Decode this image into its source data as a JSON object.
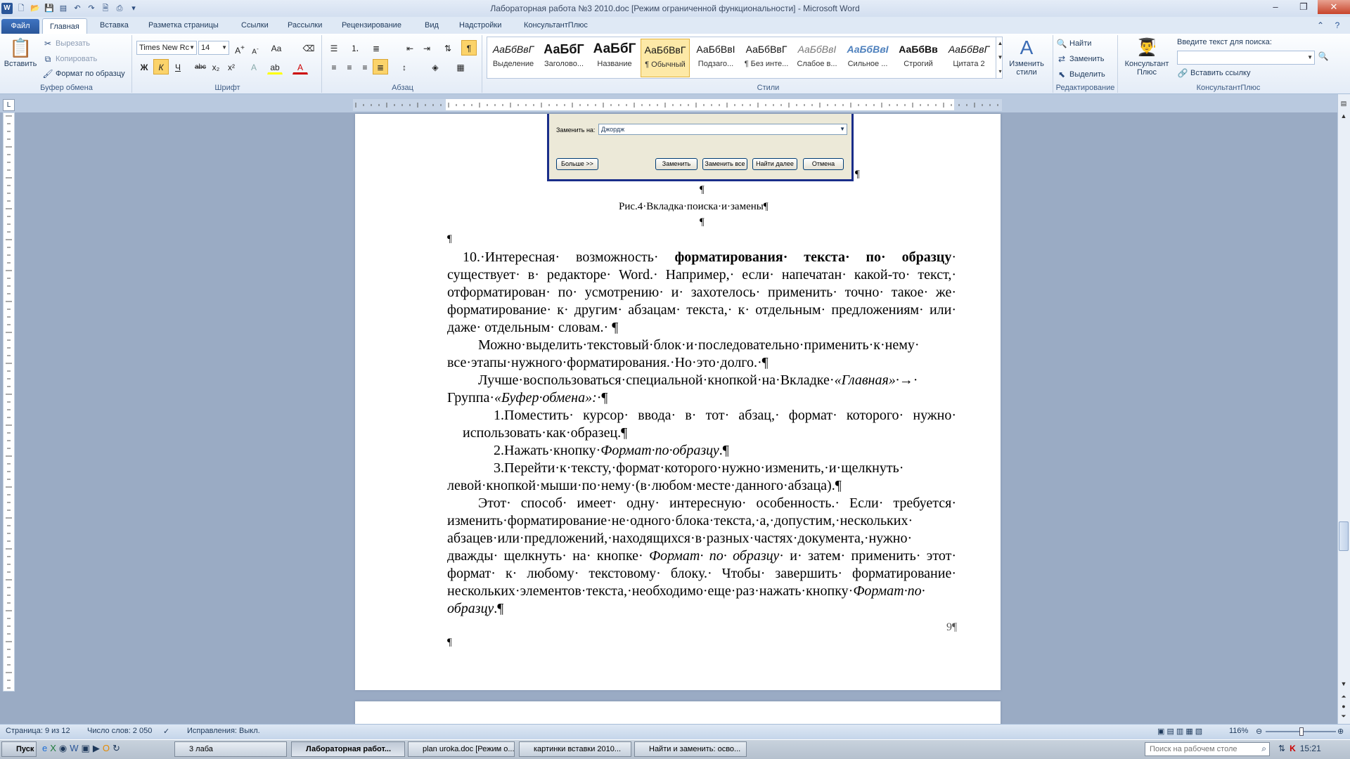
{
  "window": {
    "title": "Лабораторная работа №3 2010.doc [Режим ограниченной функциональности]  -  Microsoft Word"
  },
  "tabs": {
    "file": "Файл",
    "items": [
      "Главная",
      "Вставка",
      "Разметка страницы",
      "Ссылки",
      "Рассылки",
      "Рецензирование",
      "Вид",
      "Надстройки",
      "КонсультантПлюс"
    ]
  },
  "ribbon": {
    "clipboard": {
      "label": "Буфер обмена",
      "paste": "Вставить",
      "cut": "Вырезать",
      "copy": "Копировать",
      "format_painter": "Формат по образцу"
    },
    "font": {
      "label": "Шрифт",
      "name": "Times New Rc",
      "size": "14"
    },
    "paragraph": {
      "label": "Абзац"
    },
    "styles": {
      "label": "Стили",
      "items": [
        {
          "sample": "АаБбВвГ",
          "name": "Выделение"
        },
        {
          "sample": "АаБбГ",
          "name": "Заголово..."
        },
        {
          "sample": "АаБбГ",
          "name": "Название"
        },
        {
          "sample": "АаБбВвГ",
          "name": "¶ Обычный"
        },
        {
          "sample": "АаБбВвІ",
          "name": "Подзаго..."
        },
        {
          "sample": "АаБбВвГ",
          "name": "¶ Без инте..."
        },
        {
          "sample": "АаБбВвІ",
          "name": "Слабое в..."
        },
        {
          "sample": "АаБбВвІ",
          "name": "Сильное ..."
        },
        {
          "sample": "АаБбВв",
          "name": "Строгий"
        },
        {
          "sample": "АаБбВвГ",
          "name": "Цитата 2"
        }
      ],
      "change_styles": "Изменить стили"
    },
    "editing": {
      "label": "Редактирование",
      "find": "Найти",
      "replace": "Заменить",
      "select": "Выделить"
    },
    "consultant": {
      "label": "КонсультантПлюс",
      "button": "Консультант Плюс",
      "search_label": "Введите текст для поиска:",
      "insert_link": "Вставить ссылку"
    }
  },
  "dialog": {
    "replace_label": "Заменить на:",
    "replace_value": "Джордж",
    "more": "Больше >>",
    "replace": "Заменить",
    "replace_all": "Заменить все",
    "find_next": "Найти далее",
    "cancel": "Отмена"
  },
  "document": {
    "caption": "Рис.4·Вкладка·поиска·и·замены¶",
    "pilcrow": "¶",
    "page_number": "9¶",
    "p1_a": "10.·Интересная· возможность· ",
    "p1_b": "форматирования· текста· по· образцу",
    "p1_c": "· существует· в· редакторе· Word.· Например,· если· напечатан· какой-то· текст,· отформатирован· по· усмотрению· и· захотелось· применить· точно· такое· же· форматирование· к· другим· абзацам· текста,· к· отдельным· предложениям· или· даже· отдельным· словам.· ¶",
    "p2": "Можно·выделить·текстовый·блок·и·последовательно·применить·к·нему· все·этапы·нужного·форматирования.·Но·это·долго.·¶",
    "p3_a": "Лучше·воспользоваться·специальной·кнопкой·на·Вкладке·",
    "p3_b": "«Главная»·",
    "p3_c": "→· Группа·",
    "p3_d": "«Буфер·обмена»:",
    "p3_e": "·¶",
    "l1": "1.Поместить· курсор· ввода· в· тот· абзац,· формат· которого· нужно· использовать·как·образец.¶",
    "l2_a": "2.Нажать·кнопку·",
    "l2_b": "Формат·по·образцу",
    "l2_c": ".¶",
    "l3": "3.Перейти·к·тексту,·формат·которого·нужно·изменить,·и·щелкнуть· левой·кнопкой·мыши·по·нему·(в·любом·месте·данного·абзаца).¶",
    "p4_a": "Этот· способ· имеет· одну· интересную· особенность.· Если· требуется· изменить·форматирование·не·одного·блока·текста,·а,·допустим,·нескольких· абзацев·или·предложений,·находящихся·в·разных·частях·документа,·нужно· дважды· щелкнуть· на· кнопке· ",
    "p4_b": "Формат· по· образцу",
    "p4_c": "· и· затем· применить· этот· формат· к· любому· текстовому· блоку.· Чтобы· завершить· форматирование· нескольких·элементов·текста,·необходимо·еще·раз·нажать·кнопку·",
    "p4_d": "Формат·по· образцу",
    "p4_e": ".¶"
  },
  "status": {
    "page": "Страница: 9 из 12",
    "words": "Число слов: 2 050",
    "track": "Исправления: Выкл.",
    "zoom": "116%"
  },
  "taskbar": {
    "start": "Пуск",
    "items": [
      "3 лаба",
      "Лабораторная работ...",
      "plan uroka.doc [Режим о...",
      "картинки вставки 2010...",
      "Найти и заменить: осво..."
    ],
    "search_placeholder": "Поиск на рабочем столе",
    "clock": "15:21"
  }
}
